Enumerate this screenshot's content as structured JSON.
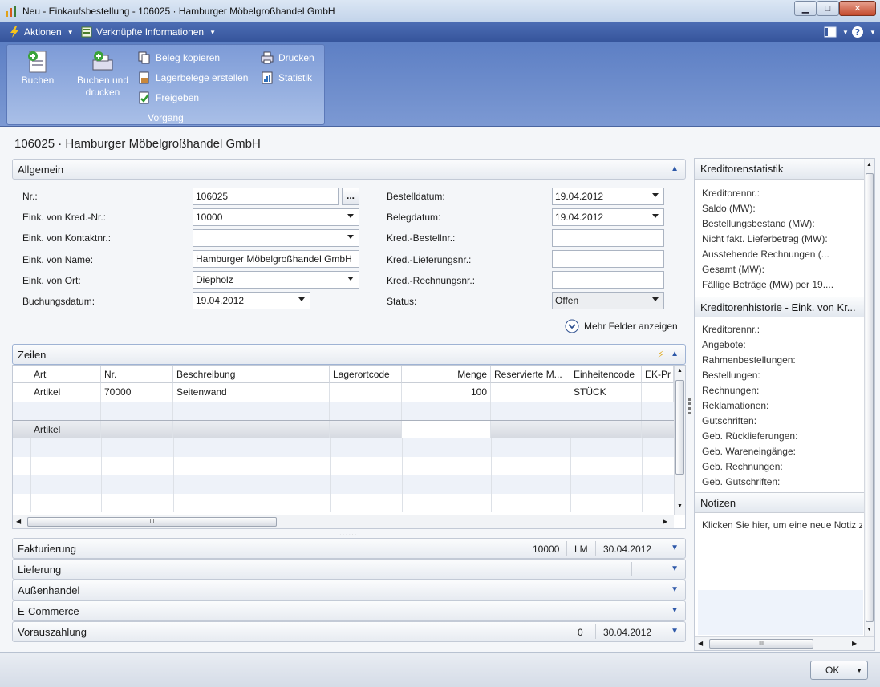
{
  "window": {
    "title": "Neu - Einkaufsbestellung - 106025 · Hamburger Möbelgroßhandel GmbH"
  },
  "menu": {
    "actions": "Aktionen",
    "related": "Verknüpfte Informationen"
  },
  "ribbon": {
    "post": "Buchen",
    "post_print_1": "Buchen und",
    "post_print_2": "drucken",
    "copy_doc": "Beleg kopieren",
    "whse_docs": "Lagerbelege erstellen",
    "release": "Freigeben",
    "print": "Drucken",
    "statistics": "Statistik",
    "group": "Vorgang"
  },
  "page": {
    "title": "106025 · Hamburger Möbelgroßhandel GmbH"
  },
  "general": {
    "header": "Allgemein",
    "fields_left": [
      {
        "label": "Nr.:",
        "value": ""
      },
      {
        "label": "Eink. von Kred.-Nr.:",
        "value": "10000"
      },
      {
        "label": "Eink. von Kontaktnr.:",
        "value": ""
      },
      {
        "label": "Eink. von Name:",
        "value": "Hamburger Möbelgroßhandel GmbH"
      },
      {
        "label": "Eink. von Ort:",
        "value": "Diepholz"
      },
      {
        "label": "Buchungsdatum:",
        "value": "19.04.2012"
      }
    ],
    "no_value": "106025",
    "assist": "...",
    "fields_right": [
      {
        "label": "Bestelldatum:",
        "value": "19.04.2012"
      },
      {
        "label": "Belegdatum:",
        "value": "19.04.2012"
      },
      {
        "label": "Kred.-Bestellnr.:",
        "value": ""
      },
      {
        "label": "Kred.-Lieferungsnr.:",
        "value": ""
      },
      {
        "label": "Kred.-Rechnungsnr.:",
        "value": ""
      },
      {
        "label": "Status:",
        "value": "Offen"
      }
    ],
    "more_fields": "Mehr Felder anzeigen"
  },
  "lines": {
    "header": "Zeilen",
    "columns": [
      "Art",
      "Nr.",
      "Beschreibung",
      "Lagerortcode",
      "Menge",
      "Reservierte M...",
      "Einheitencode",
      "EK-Pr"
    ],
    "row1": {
      "type": "Artikel",
      "no": "70000",
      "desc": "Seitenwand",
      "qty": "100",
      "unit": "STÜCK"
    },
    "row3": {
      "type": "Artikel"
    },
    "hscroll": "III",
    "splitter": "......"
  },
  "sections": [
    {
      "name": "Fakturierung",
      "v1": "10000",
      "v2": "LM",
      "v3": "30.04.2012"
    },
    {
      "name": "Lieferung",
      "v1": "",
      "v2": "",
      "v3": ""
    },
    {
      "name": "Außenhandel",
      "v1": "",
      "v2": "",
      "v3": ""
    },
    {
      "name": "E-Commerce",
      "v1": "",
      "v2": "",
      "v3": ""
    },
    {
      "name": "Vorauszahlung",
      "v1": "0",
      "v2": "",
      "v3": "30.04.2012"
    }
  ],
  "factbox": {
    "stats_title": "Kreditorenstatistik",
    "stats": [
      "Kreditorennr.:",
      "Saldo (MW):",
      "Bestellungsbestand (MW):",
      "Nicht fakt. Lieferbetrag (MW):",
      "Ausstehende Rechnungen (...",
      "Gesamt (MW):",
      "Fällige Beträge (MW) per 19...."
    ],
    "history_title": "Kreditorenhistorie - Eink. von Kr...",
    "history": [
      "Kreditorennr.:",
      "Angebote:",
      "Rahmenbestellungen:",
      "Bestellungen:",
      "Rechnungen:",
      "Reklamationen:",
      "Gutschriften:",
      "Geb. Rücklieferungen:",
      "Geb. Wareneingänge:",
      "Geb. Rechnungen:",
      "Geb. Gutschriften:"
    ],
    "notes_title": "Notizen",
    "notes_hint": "Klicken Sie hier, um eine neue Notiz zu",
    "hscroll": "III"
  },
  "footer": {
    "ok": "OK"
  }
}
